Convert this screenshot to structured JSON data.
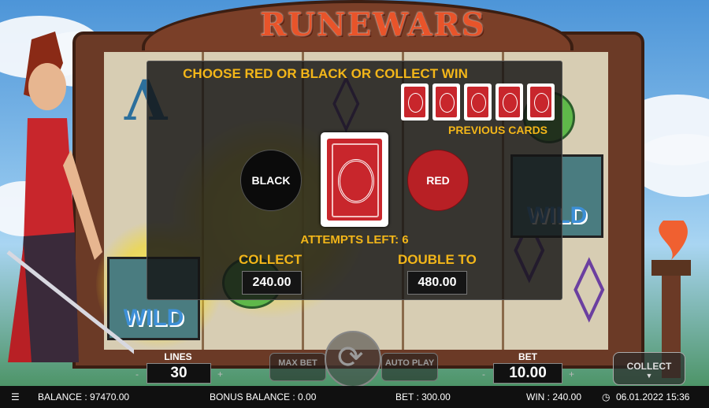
{
  "game": {
    "logo": "RUNEWARS"
  },
  "gamble": {
    "title": "CHOOSE RED OR BLACK OR COLLECT WIN",
    "previous_cards_label": "PREVIOUS CARDS",
    "previous_cards_count": 5,
    "black_label": "BLACK",
    "red_label": "RED",
    "attempts_label": "ATTEMPTS LEFT: 6",
    "collect_label": "COLLECT",
    "collect_value": "240.00",
    "double_label": "DOUBLE TO",
    "double_value": "480.00"
  },
  "controls": {
    "lines_label": "LINES",
    "lines_value": "30",
    "minus": "-",
    "plus": "+",
    "max_bet_label": "MAX BET",
    "auto_play_label": "AUTO PLAY",
    "bet_label": "BET",
    "bet_value": "10.00",
    "collect_button": "COLLECT"
  },
  "reels": {
    "wild_label": "WILD"
  },
  "status_bar": {
    "balance": "BALANCE : 97470.00",
    "bonus_balance": "BONUS BALANCE : 0.00",
    "bet": "BET : 300.00",
    "win": "WIN : 240.00",
    "datetime": "06.01.2022 15:36"
  },
  "colors": {
    "accent": "#f3b619",
    "red": "#c8262c",
    "black": "#0b0b0b"
  }
}
